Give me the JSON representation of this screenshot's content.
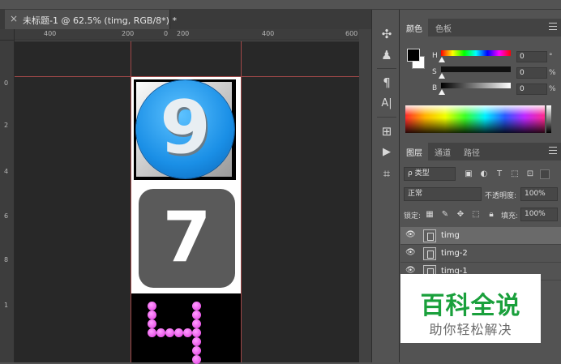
{
  "top_bar": {
    "left_text": "",
    "right_text": ""
  },
  "document_tab": {
    "close": "×",
    "title": "未标题-1 @ 62.5% (timg, RGB/8*) *"
  },
  "ruler": {
    "h_labels": [
      "400",
      "200",
      "0",
      "200",
      "400",
      "600"
    ],
    "v_labels": [
      "0",
      "2",
      "4",
      "6",
      "8",
      "1"
    ],
    "guide_color": "#a04848"
  },
  "canvas": {
    "digits": [
      "9",
      "7",
      "4"
    ],
    "colors": {
      "blue": "#1a8fe6",
      "gray_tile": "#5a5a5a",
      "magenta": "#e13ce0"
    }
  },
  "tools_panel": {
    "icons": [
      "puzzle-icon",
      "stamp-icon",
      "paragraph-icon",
      "character-icon",
      "swatch-group-icon",
      "play-icon",
      "crop-icon"
    ],
    "glyphs": [
      "✣",
      "♟",
      "¶",
      "A|",
      "⊞",
      "▶",
      "⌗"
    ]
  },
  "color_panel": {
    "tabs": [
      "颜色",
      "色板"
    ],
    "sliders": [
      {
        "label": "H",
        "value": "0",
        "unit": "°"
      },
      {
        "label": "S",
        "value": "0",
        "unit": "%"
      },
      {
        "label": "B",
        "value": "0",
        "unit": "%"
      }
    ],
    "foreground_color": "#000000",
    "background_color": "#ffffff"
  },
  "layers_panel": {
    "tabs": [
      "图层",
      "通道",
      "路径"
    ],
    "filter_kind": "ρ 类型",
    "blend_mode": "正常",
    "opacity_label": "不透明度:",
    "opacity_value": "100%",
    "lock_label": "锁定:",
    "fill_label": "填充:",
    "fill_value": "100%",
    "layers": [
      {
        "name": "timg",
        "selected": true
      },
      {
        "name": "timg-2",
        "selected": false
      },
      {
        "name": "timg-1",
        "selected": false
      }
    ]
  },
  "watermark": {
    "title": "百科全说",
    "subtitle": "助你轻松解决"
  }
}
